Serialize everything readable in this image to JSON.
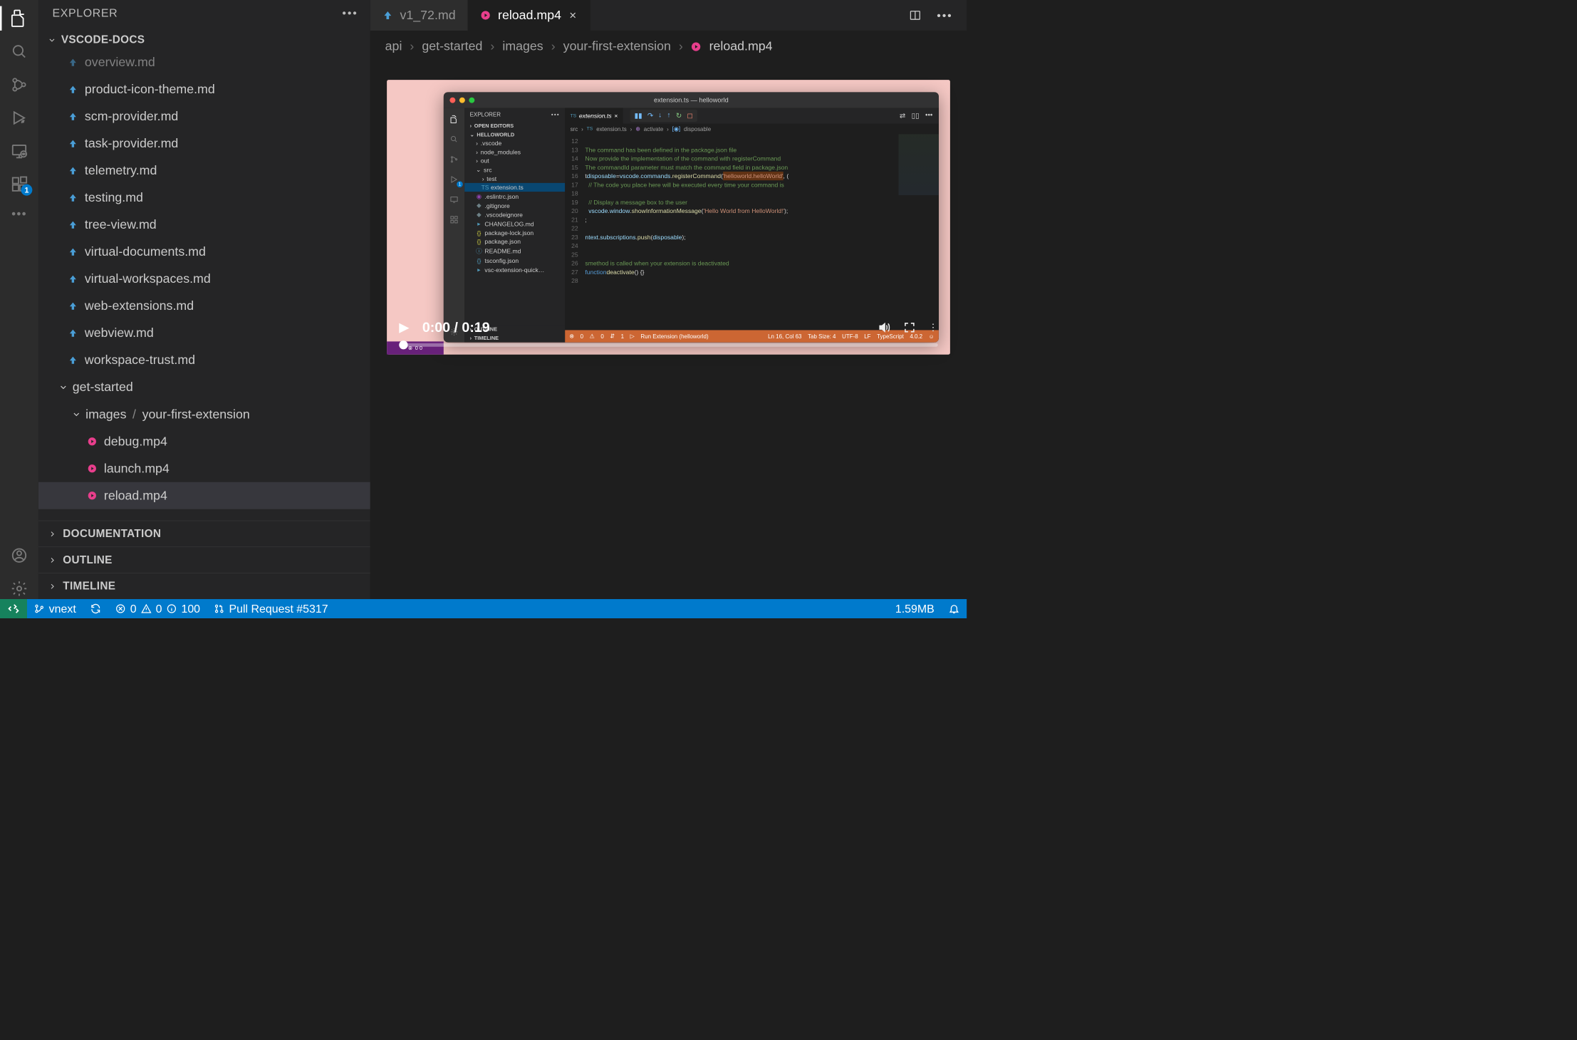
{
  "sidebar": {
    "title": "EXPLORER",
    "root": "VSCODE-DOCS",
    "files": [
      "overview.md",
      "product-icon-theme.md",
      "scm-provider.md",
      "task-provider.md",
      "telemetry.md",
      "testing.md",
      "tree-view.md",
      "virtual-documents.md",
      "virtual-workspaces.md",
      "web-extensions.md",
      "webview.md",
      "workspace-trust.md"
    ],
    "folder1": "get-started",
    "folder2a": "images",
    "folder2b": "your-first-extension",
    "mp4s": [
      "debug.mp4",
      "launch.mp4",
      "reload.mp4"
    ],
    "panels": [
      "DOCUMENTATION",
      "OUTLINE",
      "TIMELINE"
    ]
  },
  "tabs": {
    "t0": "v1_72.md",
    "t1": "reload.mp4"
  },
  "breadcrumb": [
    "api",
    "get-started",
    "images",
    "your-first-extension",
    "reload.mp4"
  ],
  "extensions_badge": "1",
  "video": {
    "time": "0:00 / 0:19",
    "inner_title": "extension.ts — helloworld",
    "inner_explorer": "EXPLORER",
    "open_editors": "OPEN EDITORS",
    "helloworld": "HELLOWORLD",
    "tree": {
      "vscode": ".vscode",
      "node_modules": "node_modules",
      "out": "out",
      "src": "src",
      "test": "test",
      "extension": "extension.ts",
      "eslintrc": ".eslintrc.json",
      "gitignore": ".gitignore",
      "vscodeignore": ".vscodeignore",
      "changelog": "CHANGELOG.md",
      "packagelock": "package-lock.json",
      "package": "package.json",
      "readme": "README.md",
      "tsconfig": "tsconfig.json",
      "quick": "vsc-extension-quick…"
    },
    "tab": "extension.ts",
    "crumb": [
      "src",
      "extension.ts",
      "activate",
      "disposable"
    ],
    "outline": "OUTLINE",
    "timeline": "TIMELINE",
    "code": {
      "l12": "",
      "l13": "The command has been defined in the package.json file",
      "l14": "Now provide the implementation of the command with registerCommand",
      "l15": "The commandId parameter must match the command field in package.json",
      "l16a": "disposable",
      "l16b": "vscode",
      "l16c": "commands",
      "l16d": "registerCommand",
      "l16e": "'helloworld.helloWorld'",
      "l17": "// The code you place here will be executed every time your command is",
      "l19": "// Display a message box to the user",
      "l20a": "vscode",
      "l20b": "window",
      "l20c": "showInformationMessage",
      "l20d": "'Hello World from HelloWorld!'",
      "l23a": "ntext",
      "l23b": "subscriptions",
      "l23c": "push",
      "l23d": "disposable",
      "l26": "method is called when your extension is deactivated",
      "l27a": "function",
      "l27b": "deactivate"
    },
    "status": {
      "errors": "0",
      "warnings": "0",
      "port": "1",
      "run": "Run Extension (helloworld)",
      "lncol": "Ln 16, Col 63",
      "tabsize": "Tab Size: 4",
      "encoding": "UTF-8",
      "eol": "LF",
      "lang": "TypeScript",
      "ver": "4.0.2"
    },
    "purple": "0  0"
  },
  "statusbar": {
    "branch": "vnext",
    "errors": "0",
    "warnings": "0",
    "info": "100",
    "pr": "Pull Request #5317",
    "size": "1.59MB"
  }
}
